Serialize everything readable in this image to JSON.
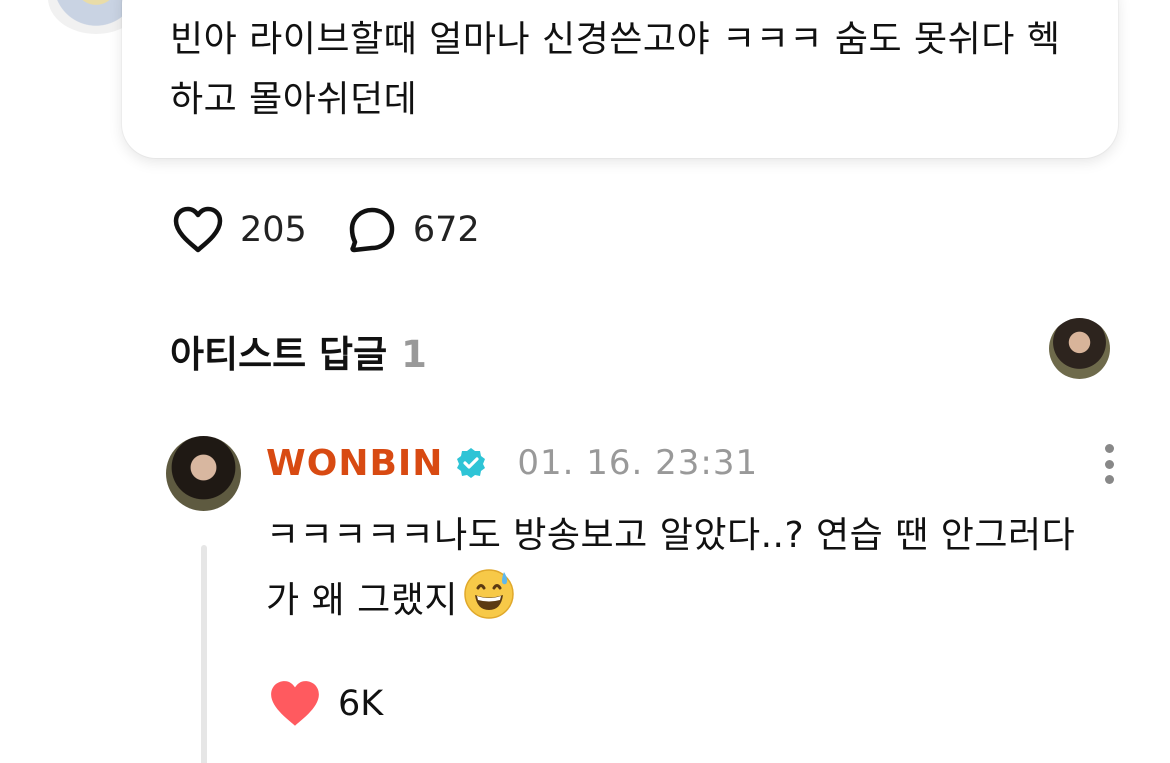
{
  "post": {
    "text": "빈아 라이브할때 얼마나 신경쓴고야 ㅋㅋㅋ 숨도 못쉬다 헥 하고 몰아쉬던데",
    "likes": "205",
    "comments": "672"
  },
  "artist_replies": {
    "title": "아티스트 답글",
    "count": "1"
  },
  "reply": {
    "author": "WONBIN",
    "timestamp": "01. 16. 23:31",
    "text": "ㅋㅋㅋㅋㅋ나도 방송보고 알았다..? 연습 땐 안그러다가 왜 그랬지",
    "likes": "6K"
  },
  "colors": {
    "author_name": "#d84a12",
    "verified_badge": "#2ec4d6",
    "liked_heart": "#ff5a5f",
    "muted_text": "#999999"
  },
  "icons": {
    "like": "heart-outline-icon",
    "comment": "speech-bubble-icon",
    "verified": "verified-badge-icon",
    "more": "kebab-menu-icon",
    "liked": "heart-filled-icon",
    "emoji": "grinning-face-with-sweat-emoji"
  }
}
